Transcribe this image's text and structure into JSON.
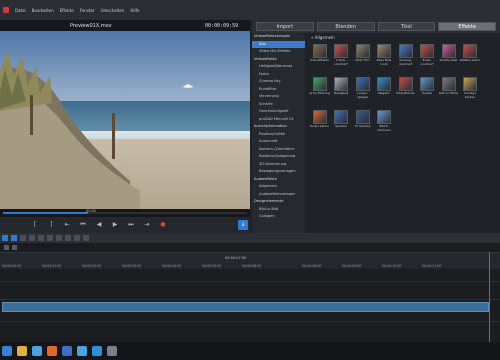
{
  "menubar": {
    "items": [
      "Datei",
      "Bearbeiten",
      "Effekte",
      "Fenster",
      "Umschalten",
      "Hilfe"
    ]
  },
  "preview": {
    "filename": "Preview01X.mxv",
    "timecode": "00:00:09:59",
    "scrub_label": "00:00",
    "scrub_progress": 0.35
  },
  "tabs": [
    {
      "label": "Import",
      "active": false
    },
    {
      "label": "Blenden",
      "active": false
    },
    {
      "label": "Titel",
      "active": false
    },
    {
      "label": "Effekte",
      "active": true
    }
  ],
  "categories": [
    {
      "label": "Videoeffektvorlagen",
      "type": "head"
    },
    {
      "label": "Alle",
      "type": "sel"
    },
    {
      "label": "Video-Mix-Effekte",
      "type": "item"
    },
    {
      "label": "Videoeffekte",
      "type": "head"
    },
    {
      "label": "Helligkeit/Kontrast",
      "type": "item"
    },
    {
      "label": "Farbe",
      "type": "item"
    },
    {
      "label": "Chroma Key",
      "type": "item"
    },
    {
      "label": "Rundfilter",
      "type": "item"
    },
    {
      "label": "Verzerrung",
      "type": "item"
    },
    {
      "label": "Schärfe",
      "type": "item"
    },
    {
      "label": "Geschwindigkeit",
      "type": "item"
    },
    {
      "label": "proDAD Mercalli V2",
      "type": "item"
    },
    {
      "label": "Ansicht/Animation",
      "type": "head"
    },
    {
      "label": "Position/Größe",
      "type": "item"
    },
    {
      "label": "Ausschnitt",
      "type": "item"
    },
    {
      "label": "Kamera-/Zoomfahrt",
      "type": "item"
    },
    {
      "label": "Rotation/Spiegelung",
      "type": "item"
    },
    {
      "label": "3D-Verformung",
      "type": "item"
    },
    {
      "label": "Bewegungsvorlagen",
      "type": "item"
    },
    {
      "label": "Audioeffekte",
      "type": "head"
    },
    {
      "label": "Allgemein",
      "type": "item"
    },
    {
      "label": "Audioeffektvorlagen",
      "type": "item"
    },
    {
      "label": "Designelemente",
      "type": "head"
    },
    {
      "label": "Bild-in-Bild",
      "type": "item"
    },
    {
      "label": "Collagen",
      "type": "item"
    }
  ],
  "effects_header": "Allgemein",
  "effects": [
    {
      "label": "Auto-Effekte",
      "color": "#8a6a4a"
    },
    {
      "label": "2 Farb-unschärf",
      "color": "#c85050"
    },
    {
      "label": "Alter Film",
      "color": "#8c7f6a"
    },
    {
      "label": "Altes Bild-Look",
      "color": "#a08868"
    },
    {
      "label": "Anhang-unscharf",
      "color": "#4a7ac0"
    },
    {
      "label": "Ende-unscharf",
      "color": "#c84a4a"
    },
    {
      "label": "Dreifar-bald",
      "color": "#d05a9a"
    },
    {
      "label": "Glätten-warm",
      "color": "#c05050"
    },
    {
      "label": "Grün-Färbung",
      "color": "#4aa060"
    },
    {
      "label": "Helligkeit",
      "color": "#b0b4ba"
    },
    {
      "label": "Linsen-spiegel",
      "color": "#3f6fb8"
    },
    {
      "label": "Negativ",
      "color": "#3a8ac0"
    },
    {
      "label": "Pixel-Blende",
      "color": "#c04a4a"
    },
    {
      "label": "Puzzle",
      "color": "#5a9acb"
    },
    {
      "label": "S/W zu Farbe",
      "color": "#7a7a7a"
    },
    {
      "label": "Sandige Kanten",
      "color": "#c8a060"
    },
    {
      "label": "Solari-sation",
      "color": "#d06a3a"
    },
    {
      "label": "Spalten",
      "color": "#4a6ab8"
    },
    {
      "label": "TV Streifen",
      "color": "#3a5a8a"
    },
    {
      "label": "Weich-zeichnen",
      "color": "#6a9ad0"
    }
  ],
  "timeline": {
    "center_timecode": "00:00:07:00",
    "ticks": [
      "00:00:00:00",
      "00:00:01:00",
      "00:00:02:00",
      "00:00:03:00",
      "00:00:04:00",
      "00:00:05:00",
      "00:00:06:00",
      "00:00:08:00",
      "00:00:09:00",
      "00:00:10:00",
      "00:00:11:00"
    ]
  },
  "taskbar": {
    "icons": [
      "start-icon",
      "file-explorer-icon",
      "chrome-icon",
      "firefox-icon",
      "media-player-icon",
      "chrome-alt-icon",
      "edge-icon",
      "video-editor-icon"
    ]
  }
}
